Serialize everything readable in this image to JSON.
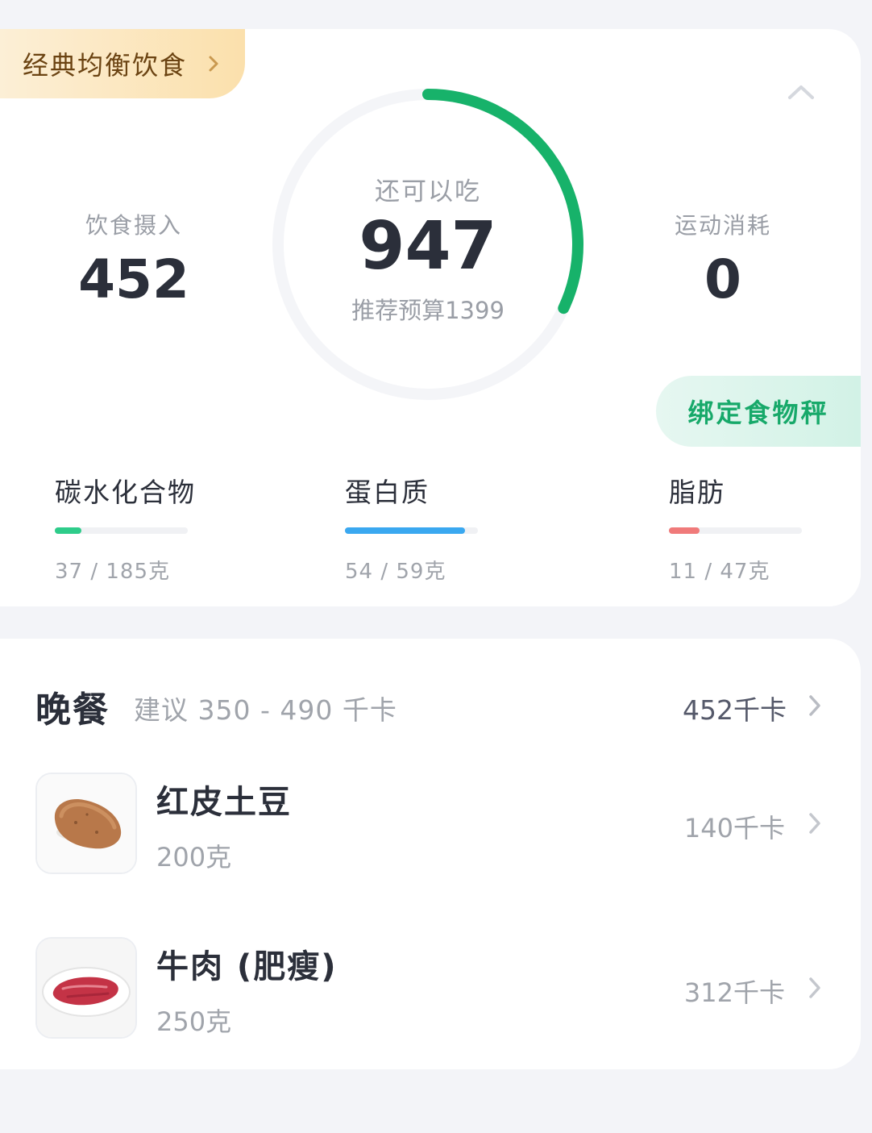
{
  "summary": {
    "plan_label": "经典均衡饮食",
    "remaining_caption": "还可以吃",
    "remaining_value": "947",
    "budget_label": "推荐预算1399",
    "intake": {
      "caption": "饮食摄入",
      "value": "452"
    },
    "exercise": {
      "caption": "运动消耗",
      "value": "0"
    },
    "bind_scale_label": "绑定食物秤",
    "ring_progress": 0.32,
    "colors": {
      "ring": "#17b26a",
      "carbs": "#2ecc8a",
      "protein": "#3aa8f0",
      "fat": "#f07a7a"
    }
  },
  "macros": [
    {
      "name": "碳水化合物",
      "amount": "37 / 185克",
      "progress": 0.2
    },
    {
      "name": "蛋白质",
      "amount": "54 / 59克",
      "progress": 0.9
    },
    {
      "name": "脂肪",
      "amount": "11 / 47克",
      "progress": 0.23
    }
  ],
  "meal": {
    "title": "晚餐",
    "suggestion": "建议 350 - 490 千卡",
    "total": "452千卡",
    "foods": [
      {
        "name": "红皮土豆",
        "weight": "200克",
        "kcal": "140千卡"
      },
      {
        "name": "牛肉 (肥瘦)",
        "weight": "250克",
        "kcal": "312千卡"
      }
    ]
  }
}
